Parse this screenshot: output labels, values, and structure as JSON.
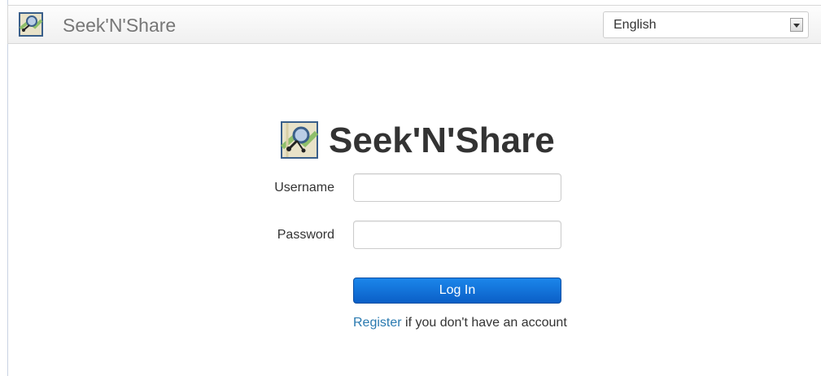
{
  "app": {
    "name": "Seek'N'Share"
  },
  "header": {
    "title": "Seek'N'Share",
    "language_selected": "English",
    "logo_icon": "map-pin-logo-icon"
  },
  "login": {
    "heading": "Seek'N'Share",
    "username_label": "Username",
    "username_value": "",
    "password_label": "Password",
    "password_value": "",
    "submit_label": "Log In",
    "register_link": "Register",
    "register_suffix": " if you don't have an account"
  },
  "colors": {
    "primary_button": "#1b86ea",
    "link": "#2a7ab0",
    "text": "#333333"
  }
}
